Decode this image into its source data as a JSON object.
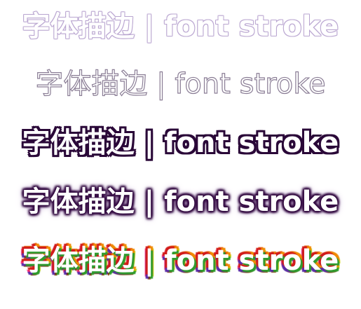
{
  "demos": [
    {
      "text": "字体描边 | font stroke"
    },
    {
      "text": "字体描边 | font stroke"
    },
    {
      "text": "字体描边 | font stroke"
    },
    {
      "text": "字体描边 | font stroke"
    },
    {
      "text": "字体描边 | font stroke"
    }
  ],
  "colors": {
    "background": "#ffffff",
    "stroke_dark_purple": "#2a0838",
    "stroke_light_purple": "#b8a4cf",
    "stroke_gray_purple": "#8a7d95"
  }
}
